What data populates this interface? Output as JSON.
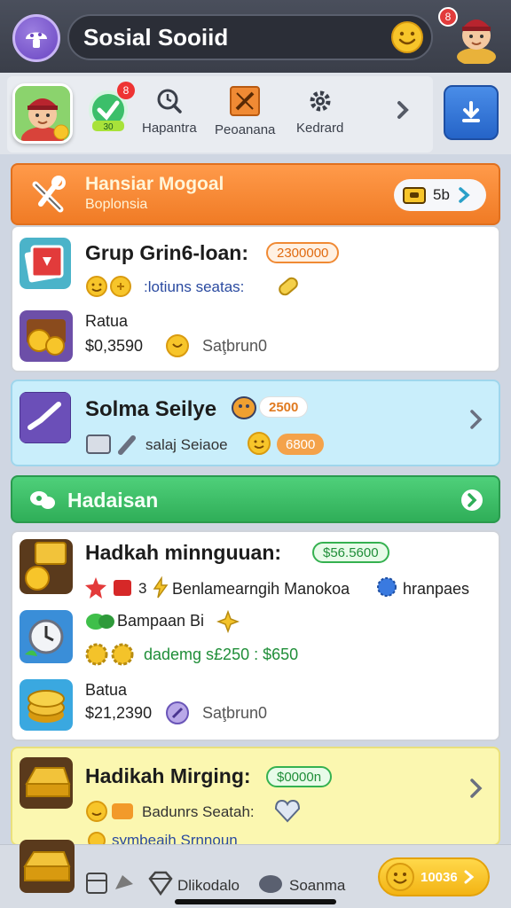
{
  "header": {
    "search_text": "Sosial Sooiid",
    "notification_count": "8"
  },
  "nav": {
    "badge": "8",
    "items": [
      {
        "label": "Hapantra"
      },
      {
        "label": "Peoanana"
      },
      {
        "label": "Kedrard"
      }
    ],
    "check_badge": "30"
  },
  "promo": {
    "title": "Hansiar Mogoal",
    "subtitle": "Boplonsia",
    "coin_value": "5b"
  },
  "card1": {
    "title": "Grup Grin6-loan:",
    "tag": "2300000",
    "line2": ":lotiuns seatas:",
    "row_title": "Ratua",
    "price": "$0,3590",
    "status": "Saţbrun0"
  },
  "card2": {
    "title": "Solma Seilye",
    "tag": "2500",
    "line2": "salaj Seiaoe",
    "tag2": "6800"
  },
  "section2": {
    "title": "Hadaisan"
  },
  "card3": {
    "title": "Hadkah minnguuan:",
    "tag": "$56.5600",
    "line2_count": "3",
    "line2": "Benlamearngih Manokoa",
    "line2_end": "hranpaes",
    "line3": "Bampaan Bi",
    "line4": "dademg s£250 : $650",
    "row_title": "Batua",
    "price": "$21,2390",
    "status": "Saţbrun0"
  },
  "card4": {
    "title": "Hadikah Mirging:",
    "tag": "$0000n",
    "line2": "Badunrs Seatah:",
    "line3": "symbeaih Srnnoun"
  },
  "bottom": {
    "item1": "Dlikodalo",
    "item2": "Soanma",
    "pill_value": "10036"
  },
  "colors": {
    "accent_purple": "#6a45c2",
    "orange": "#f07b25",
    "green": "#2fae58",
    "light_blue": "#c9eefb",
    "yellow": "#fbf7b0"
  }
}
